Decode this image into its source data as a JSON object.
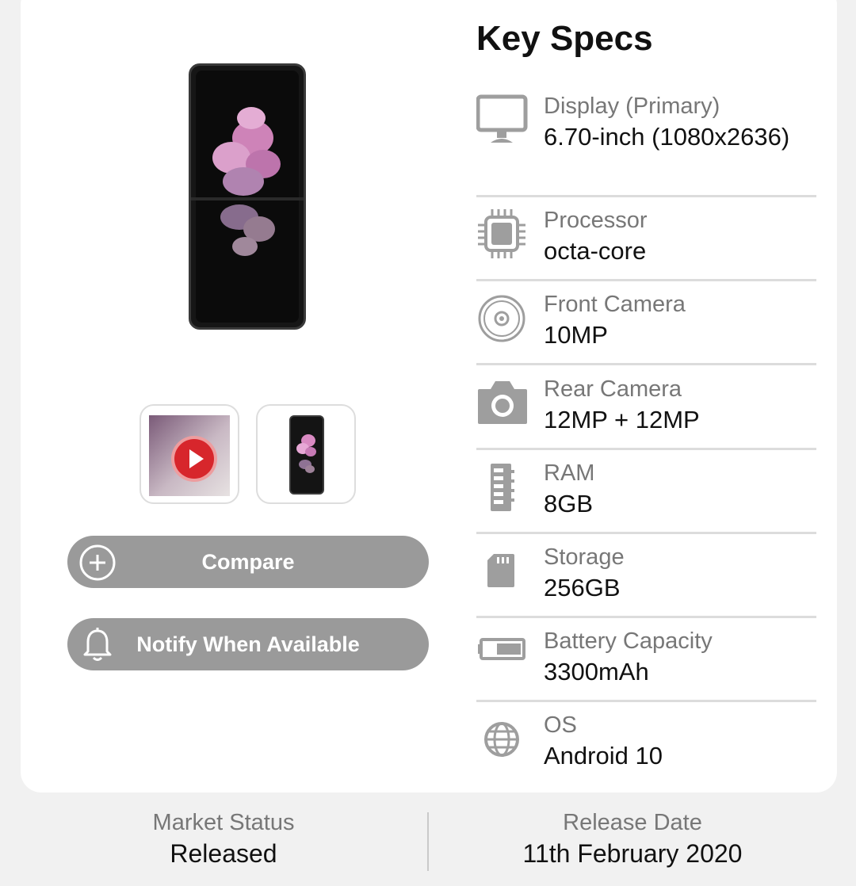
{
  "key_specs": {
    "title": "Key Specs",
    "items": [
      {
        "label": "Display (Primary)",
        "value": "6.70-inch (1080x2636)",
        "icon": "monitor-icon"
      },
      {
        "label": "Processor",
        "value": "octa-core",
        "icon": "cpu-icon"
      },
      {
        "label": "Front Camera",
        "value": "10MP",
        "icon": "front-camera-icon"
      },
      {
        "label": "Rear Camera",
        "value": "12MP + 12MP",
        "icon": "camera-icon"
      },
      {
        "label": "RAM",
        "value": "8GB",
        "icon": "ram-icon"
      },
      {
        "label": "Storage",
        "value": "256GB",
        "icon": "sd-card-icon"
      },
      {
        "label": "Battery Capacity",
        "value": "3300mAh",
        "icon": "battery-icon"
      },
      {
        "label": "OS",
        "value": "Android 10",
        "icon": "globe-icon"
      }
    ]
  },
  "actions": {
    "compare_label": "Compare",
    "notify_label": "Notify When Available"
  },
  "status_bar": {
    "market_status_label": "Market Status",
    "market_status_value": "Released",
    "release_date_label": "Release Date",
    "release_date_value": "11th February 2020"
  },
  "colors": {
    "button_bg": "#9a9a9a",
    "icon_gray": "#9e9e9e",
    "play_red": "#d7262c"
  }
}
